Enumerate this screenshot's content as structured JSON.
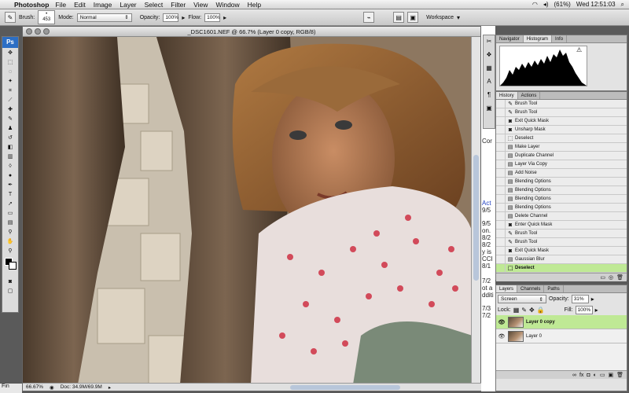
{
  "menubar": {
    "apple": "",
    "app": "Photoshop",
    "items": [
      "File",
      "Edit",
      "Image",
      "Layer",
      "Select",
      "Filter",
      "View",
      "Window",
      "Help"
    ],
    "battery": "(61%)",
    "clock": "Wed 12:51:03"
  },
  "options": {
    "brush_label": "Brush:",
    "brush_size": "453",
    "mode_label": "Mode:",
    "mode_value": "Normal",
    "opacity_label": "Opacity:",
    "opacity_value": "100%",
    "flow_label": "Flow:",
    "flow_value": "100%",
    "workspace_label": "Workspace"
  },
  "toolbox": {
    "logo": "Ps"
  },
  "document": {
    "title": "_DSC1601.NEF @ 66.7% (Layer 0 copy, RGB/8)",
    "zoom": "66.67%",
    "doc_size": "Doc: 34.9M/69.9M"
  },
  "underlying": {
    "lines": [
      "Cor",
      "Act",
      "9/5",
      "9/5",
      "8/2",
      "on.",
      "8/2",
      "y is",
      "CCI",
      "8/1",
      "7/2",
      "ot a",
      "dditi",
      "7/3",
      "7/2"
    ]
  },
  "nav_panel": {
    "tabs": [
      "Navigator",
      "Histogram",
      "Info"
    ],
    "active": 1
  },
  "history_panel": {
    "tabs": [
      "History",
      "Actions"
    ],
    "items": [
      "Brush Tool",
      "Brush Tool",
      "Exit Quick Mask",
      "Unsharp Mask",
      "Deselect",
      "Make Layer",
      "Duplicate Channel",
      "Layer Via Copy",
      "Add Noise",
      "Blending Options",
      "Blending Options",
      "Blending Options",
      "Blending Options",
      "Delete Channel",
      "Enter Quick Mask",
      "Brush Tool",
      "Brush Tool",
      "Exit Quick Mask",
      "Gaussian Blur",
      "Deselect"
    ],
    "active_index": 19
  },
  "layers_panel": {
    "tabs": [
      "Layers",
      "Channels",
      "Paths"
    ],
    "blend_mode": "Screen",
    "opacity_label": "Opacity:",
    "opacity_value": "31%",
    "lock_label": "Lock:",
    "fill_label": "Fill:",
    "fill_value": "100%",
    "layers": [
      "Layer 0 copy",
      "Layer 0"
    ],
    "active_index": 0
  },
  "dock": {
    "label": "Fin"
  }
}
